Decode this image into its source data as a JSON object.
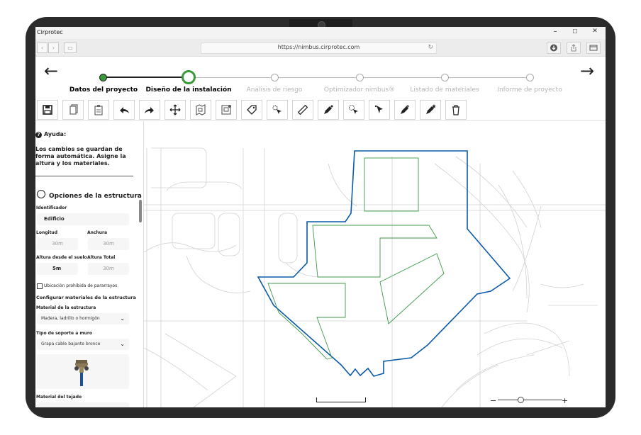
{
  "window": {
    "app_title": "Cirprotec",
    "minimize": "–",
    "maximize": "☐",
    "close": "✕"
  },
  "browser": {
    "url": "https://nimbus.cirprotec.com"
  },
  "stepper": {
    "back_label": "←",
    "forward_label": "→",
    "steps": [
      {
        "label": "Datos del proyecto",
        "state": "done"
      },
      {
        "label": "Diseño de la instalación",
        "state": "current"
      },
      {
        "label": "Análisis de riesgo",
        "state": "pending"
      },
      {
        "label": "Optimizador nimbus®",
        "state": "pending"
      },
      {
        "label": "Listado de materiales",
        "state": "pending"
      },
      {
        "label": "Informe de proyecto",
        "state": "pending"
      }
    ]
  },
  "toolbar": {
    "tools": [
      "save-icon",
      "copy-icon",
      "paste-icon",
      "undo-icon",
      "redo-icon",
      "move-icon",
      "plan-icon",
      "plan-settings-icon",
      "tag-icon",
      "select-cursor-icon",
      "ruler-icon",
      "pen-icon",
      "select-add-icon",
      "pointer-icon",
      "pen-add-icon",
      "pen-star-icon",
      "trash-icon"
    ]
  },
  "sidebar": {
    "help_title": "Ayuda:",
    "help_text": "Los cambios se guardan de forma automática. Asigne la altura y los materiales.",
    "section_title": "Opciones de la estructura",
    "identifier_label": "Identificador",
    "identifier_value": "Edificio",
    "length_label": "Longitud",
    "length_placeholder": "30m",
    "width_label": "Anchura",
    "width_placeholder": "30m",
    "height_ground_label": "Altura desde el suelo",
    "height_ground_value": "5m",
    "total_height_label": "Altura Total",
    "total_height_placeholder": "30m",
    "checkbox_label": "Ubicación prohibida de pararrayos",
    "config_materials_label": "Configurar materiales de la estructura",
    "structure_material_label": "Material de la estructura",
    "structure_material_value": "Madera, ladrillo o hormigón",
    "wall_support_label": "Tipo de soporte a muro",
    "wall_support_value": "Grapa cable bajante bronce",
    "roof_material_label": "Material del tejado"
  },
  "map": {
    "zoom_minus": "−",
    "zoom_plus": "+",
    "zoom_level": 0.3
  },
  "colors": {
    "accent_green": "#3a9a3a",
    "outline_blue": "#0b5aa8",
    "inner_green": "#3c9a4a"
  }
}
